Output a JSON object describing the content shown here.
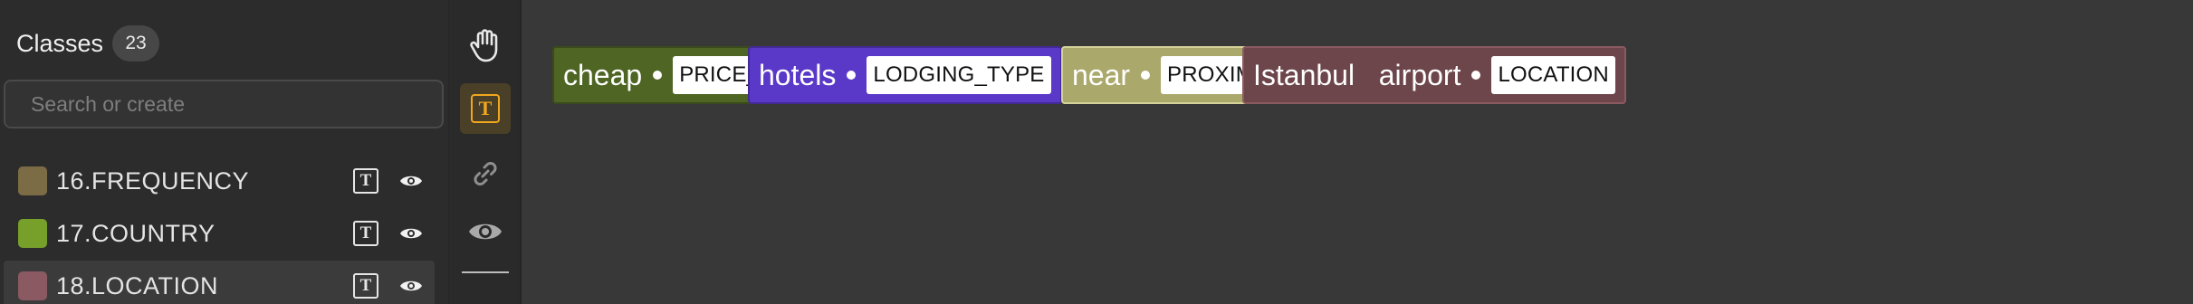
{
  "sidebar": {
    "title": "Classes",
    "count": "23",
    "search_placeholder": "Search or create",
    "items": [
      {
        "label": "16.FREQUENCY",
        "color": "#7c6c46"
      },
      {
        "label": "17.COUNTRY",
        "color": "#77a02a"
      },
      {
        "label": "18.LOCATION",
        "color": "#8a5961"
      }
    ],
    "type_icon_glyph": "T"
  },
  "toolbar": {
    "tools": [
      "hand-tool",
      "text-tool",
      "link-tool",
      "visibility-tool"
    ],
    "active_tool": "text-tool",
    "type_icon_glyph": "T"
  },
  "annotations": [
    {
      "text": "cheap",
      "label": "PRICE_TIER",
      "color": "#4e6524"
    },
    {
      "text": "hotels",
      "label": "LODGING_TYPE",
      "color": "#5a39c9"
    },
    {
      "text": "near",
      "label": "PROXIMITY",
      "color": "#aaa86b"
    },
    {
      "text": "Istanbul   airport",
      "label": "LOCATION",
      "color": "#6d464b"
    }
  ]
}
